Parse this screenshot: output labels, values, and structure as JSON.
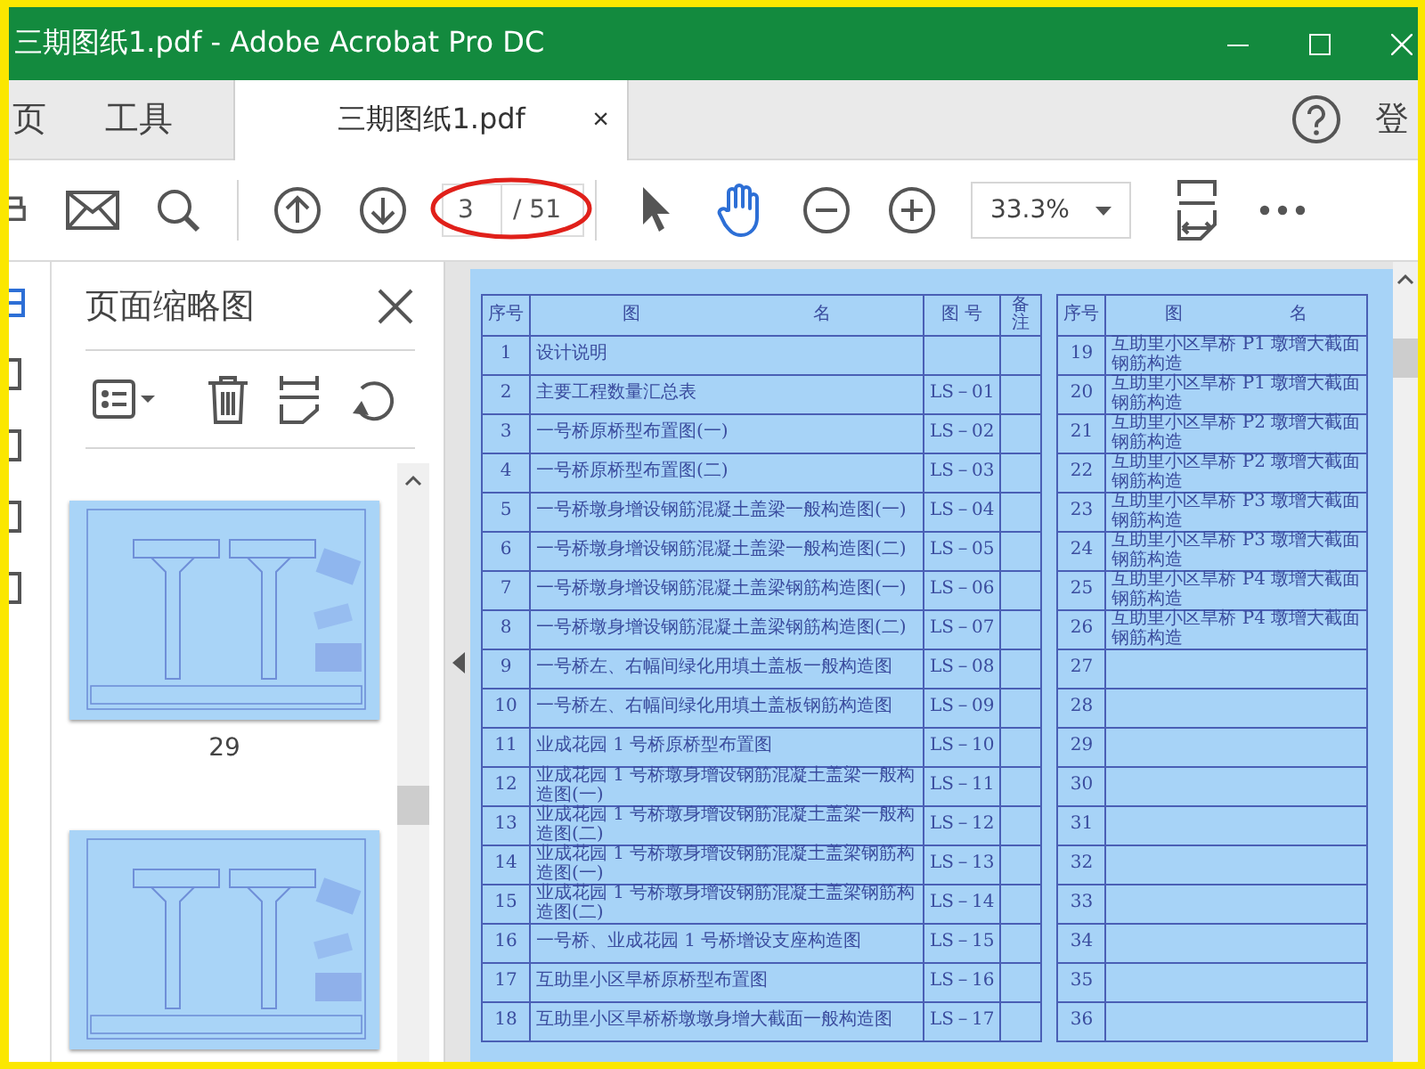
{
  "window": {
    "title": "三期图纸1.pdf - Adobe Acrobat Pro DC"
  },
  "nav": [
    {
      "label": "页"
    },
    {
      "label": "工具"
    }
  ],
  "doc_tab": {
    "label": "三期图纸1.pdf",
    "close": "×"
  },
  "sign_in": "登",
  "toolbar": {
    "page_number": "3",
    "page_total": "/ 51",
    "zoom": "33.3%",
    "tools": [
      {
        "kind": "select",
        "selected": false
      },
      {
        "kind": "hand",
        "selected": true
      }
    ]
  },
  "thumbnails_panel": {
    "title": "页面缩略图",
    "pages": [
      {
        "kind": "picture",
        "label": "29"
      },
      {
        "kind": "picture"
      }
    ]
  },
  "document": {
    "tables": [
      {
        "columns": [
          {
            "kind": "index",
            "label": "序号"
          },
          {
            "kind": "name",
            "words": [
              "图",
              "名"
            ]
          },
          {
            "kind": "code",
            "label": "图 号"
          },
          {
            "kind": "note",
            "label": "备注"
          }
        ],
        "rows": [
          {
            "no": "1",
            "name": "设计说明"
          },
          {
            "no": "2",
            "name": "主要工程数量汇总表",
            "code": "LS－01"
          },
          {
            "no": "3",
            "name": "一号桥原桥型布置图(一)",
            "code": "LS－02"
          },
          {
            "no": "4",
            "name": "一号桥原桥型布置图(二)",
            "code": "LS－03"
          },
          {
            "no": "5",
            "name": "一号桥墩身增设钢筋混凝土盖梁一般构造图(一)",
            "code": "LS－04"
          },
          {
            "no": "6",
            "name": "一号桥墩身增设钢筋混凝土盖梁一般构造图(二)",
            "code": "LS－05"
          },
          {
            "no": "7",
            "name": "一号桥墩身增设钢筋混凝土盖梁钢筋构造图(一)",
            "code": "LS－06"
          },
          {
            "no": "8",
            "name": "一号桥墩身增设钢筋混凝土盖梁钢筋构造图(二)",
            "code": "LS－07"
          },
          {
            "no": "9",
            "name": "一号桥左、右幅间绿化用填土盖板一般构造图",
            "code": "LS－08"
          },
          {
            "no": "10",
            "name": "一号桥左、右幅间绿化用填土盖板钢筋构造图",
            "code": "LS－09"
          },
          {
            "no": "11",
            "name": "业成花园 1 号桥原桥型布置图",
            "code": "LS－10"
          },
          {
            "no": "12",
            "name": "业成花园 1 号桥墩身增设钢筋混凝土盖梁一般构造图(一)",
            "code": "LS－11"
          },
          {
            "no": "13",
            "name": "业成花园 1 号桥墩身增设钢筋混凝土盖梁一般构造图(二)",
            "code": "LS－12"
          },
          {
            "no": "14",
            "name": "业成花园 1 号桥墩身增设钢筋混凝土盖梁钢筋构造图(一)",
            "code": "LS－13"
          },
          {
            "no": "15",
            "name": "业成花园 1 号桥墩身增设钢筋混凝土盖梁钢筋构造图(二)",
            "code": "LS－14"
          },
          {
            "no": "16",
            "name": "一号桥、业成花园 1 号桥增设支座构造图",
            "code": "LS－15"
          },
          {
            "no": "17",
            "name": "互助里小区旱桥原桥型布置图",
            "code": "LS－16"
          },
          {
            "no": "18",
            "name": "互助里小区旱桥桥墩墩身增大截面一般构造图",
            "code": "LS－17"
          }
        ]
      },
      {
        "columns": [
          {
            "kind": "index",
            "label": "序号"
          },
          {
            "kind": "name",
            "words": [
              "图",
              "名"
            ]
          }
        ],
        "rows": [
          {
            "no": "19",
            "name": "互助里小区旱桥 P1 墩增大截面钢筋构造"
          },
          {
            "no": "20",
            "name": "互助里小区旱桥 P1 墩增大截面钢筋构造"
          },
          {
            "no": "21",
            "name": "互助里小区旱桥 P2 墩增大截面钢筋构造"
          },
          {
            "no": "22",
            "name": "互助里小区旱桥 P2 墩增大截面钢筋构造"
          },
          {
            "no": "23",
            "name": "互助里小区旱桥 P3 墩增大截面钢筋构造"
          },
          {
            "no": "24",
            "name": "互助里小区旱桥 P3 墩增大截面钢筋构造"
          },
          {
            "no": "25",
            "name": "互助里小区旱桥 P4 墩增大截面钢筋构造"
          },
          {
            "no": "26",
            "name": "互助里小区旱桥 P4 墩增大截面钢筋构造"
          },
          {
            "no": "27"
          },
          {
            "no": "28"
          },
          {
            "no": "29"
          },
          {
            "no": "30"
          },
          {
            "no": "31"
          },
          {
            "no": "32"
          },
          {
            "no": "33"
          },
          {
            "no": "34"
          },
          {
            "no": "35"
          },
          {
            "no": "36"
          }
        ]
      }
    ]
  }
}
